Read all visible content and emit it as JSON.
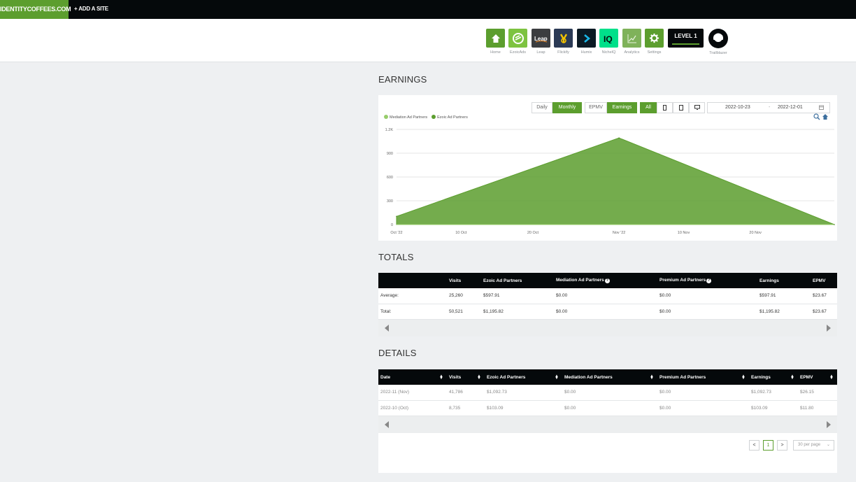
{
  "topbar": {
    "site": "IDENTITYCOFFEES.COM",
    "add_site": "+ ADD A SITE"
  },
  "apps": [
    {
      "label": "Home",
      "icon": "home-icon",
      "color": "#5c9e2e"
    },
    {
      "label": "EzoicAds",
      "icon": "ezoicads-icon",
      "color": "#7dc340"
    },
    {
      "label": "Leap",
      "icon": "leap-icon",
      "color": "#3b3d40"
    },
    {
      "label": "Flickify",
      "icon": "flickify-icon",
      "color": "#2b3a55"
    },
    {
      "label": "Humix",
      "icon": "humix-icon",
      "color": "#0b1a24"
    },
    {
      "label": "NicheIQ",
      "icon": "iq-icon",
      "color": "#00e08a"
    },
    {
      "label": "Analytics",
      "icon": "analytics-icon",
      "color": "#7fb25a"
    },
    {
      "label": "Settings",
      "icon": "gear-icon",
      "color": "#5c9e2e"
    }
  ],
  "level": {
    "label": "LEVEL 1"
  },
  "trailblazer": {
    "label": "Trailblazer"
  },
  "earnings": {
    "title": "EARNINGS",
    "buttons": {
      "daily": "Daily",
      "monthly": "Monthly",
      "epmv": "EPMV",
      "earnings": "Earnings",
      "all": "All"
    },
    "date_from": "2022-10-23",
    "date_sep": "-",
    "date_to": "2022-12-01"
  },
  "chart_data": {
    "type": "area",
    "legend": [
      "Mediation Ad Partners",
      "Ezoic Ad Partners"
    ],
    "legend_colors": [
      "#97cd6b",
      "#5c9e2e"
    ],
    "x_ticks": [
      "Oct '22",
      "10 Oct",
      "20 Oct",
      "Nov '22",
      "10 Nov",
      "20 Nov"
    ],
    "y_ticks": [
      "1.2K",
      "900",
      "600",
      "300",
      "0"
    ],
    "ylim": [
      0,
      1200
    ],
    "series": [
      {
        "name": "Mediation Ad Partners",
        "x": [
          "2022-10-01",
          "2022-11-01",
          "2022-12-01"
        ],
        "values": [
          0,
          0,
          0
        ]
      },
      {
        "name": "Ezoic Ad Partners",
        "x": [
          "2022-10-01",
          "2022-11-01",
          "2022-12-01"
        ],
        "values": [
          103.09,
          1092.73,
          0
        ]
      }
    ],
    "xlim": [
      "2022-10-01",
      "2022-12-01"
    ]
  },
  "totals": {
    "title": "TOTALS",
    "headers": [
      "",
      "Visits",
      "Ezoic Ad Partners",
      "Mediation Ad Partners",
      "Premium Ad Partners",
      "Earnings",
      "EPMV"
    ],
    "rows": [
      [
        "Average:",
        "25,260",
        "$597.91",
        "$0.00",
        "$0.00",
        "$597.91",
        "$23.67"
      ],
      [
        "Total:",
        "50,521",
        "$1,195.82",
        "$0.00",
        "$0.00",
        "$1,195.82",
        "$23.67"
      ]
    ]
  },
  "details": {
    "title": "DETAILS",
    "headers": [
      "Date",
      "Visits",
      "Ezoic Ad Partners",
      "Mediation Ad Partners",
      "Premium Ad Partners",
      "Earnings",
      "EPMV"
    ],
    "rows": [
      [
        "2022-11 (Nov)",
        "41,786",
        "$1,092.73",
        "$0.00",
        "$0.00",
        "$1,092.73",
        "$26.15"
      ],
      [
        "2022-10 (Oct)",
        "8,735",
        "$103.09",
        "$0.00",
        "$0.00",
        "$103.09",
        "$11.80"
      ]
    ],
    "pagination": {
      "prev": "<",
      "page": "1",
      "next": ">",
      "per_page": "30 per page"
    }
  }
}
